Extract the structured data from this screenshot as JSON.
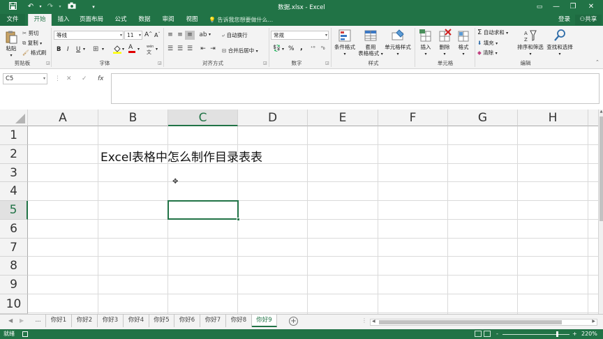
{
  "title": "数据.xlsx - Excel",
  "quick_access": {
    "save_icon": "save-icon",
    "undo_icon": "undo-icon",
    "redo_icon": "redo-icon",
    "camera_icon": "camera-icon",
    "customize_icon": "customize-icon"
  },
  "window": {
    "ribbon_opts": "▭",
    "minimize": "—",
    "restore": "❐",
    "close": "✕"
  },
  "tabs": [
    "文件",
    "开始",
    "插入",
    "页面布局",
    "公式",
    "数据",
    "审阅",
    "视图"
  ],
  "tell_me": "告诉我您想要做什么...",
  "login": "登录",
  "share": "共享",
  "ribbon": {
    "clipboard": {
      "paste": "粘贴",
      "cut": "剪切",
      "copy": "复制",
      "format_painter": "格式刷",
      "label": "剪贴板"
    },
    "font": {
      "name": "等线",
      "size": "11",
      "bold": "B",
      "italic": "I",
      "underline": "U",
      "grow": "A",
      "shrink": "A",
      "color_letter": "A",
      "label": "字体",
      "pinyin": "wén"
    },
    "alignment": {
      "wrap": "自动换行",
      "merge": "合并后居中",
      "label": "对齐方式"
    },
    "number": {
      "format": "常规",
      "percent": "%",
      "comma": ",",
      "label": "数字"
    },
    "styles": {
      "conditional": "条件格式",
      "table_line1": "套用",
      "table_line2": "表格格式",
      "cell_styles": "单元格样式",
      "label": "样式"
    },
    "cells": {
      "insert": "插入",
      "delete": "删除",
      "format": "格式",
      "label": "单元格"
    },
    "editing": {
      "autosum": "自动求和",
      "fill": "填充",
      "clear": "清除",
      "sort": "排序和筛选",
      "find": "查找和选择",
      "label": "编辑"
    }
  },
  "formula_bar": {
    "name_box": "C5",
    "cancel": "✕",
    "enter": "✓",
    "fx": "fx",
    "value": ""
  },
  "grid": {
    "columns": [
      "A",
      "B",
      "C",
      "D",
      "E",
      "F",
      "G",
      "H"
    ],
    "rows": [
      "1",
      "2",
      "3",
      "4",
      "5",
      "6",
      "7",
      "8",
      "9",
      "10"
    ],
    "selected_column": "C",
    "selected_row": "5",
    "selected_cell": "C5",
    "cells": {
      "B2": "Excel表格中怎么制作目录表表"
    }
  },
  "sheets": {
    "ellipsis": "...",
    "tabs": [
      "你好1",
      "你好2",
      "你好3",
      "你好4",
      "你好5",
      "你好6",
      "你好7",
      "你好8",
      "你好9"
    ],
    "active": "你好9",
    "add": "+"
  },
  "status": {
    "ready": "就绪",
    "zoom": "220%",
    "zoom_minus": "-",
    "zoom_plus": "+"
  },
  "colors": {
    "accent": "#217346",
    "ribbon_bg": "#f3f3f3",
    "gridline": "#dadada"
  }
}
